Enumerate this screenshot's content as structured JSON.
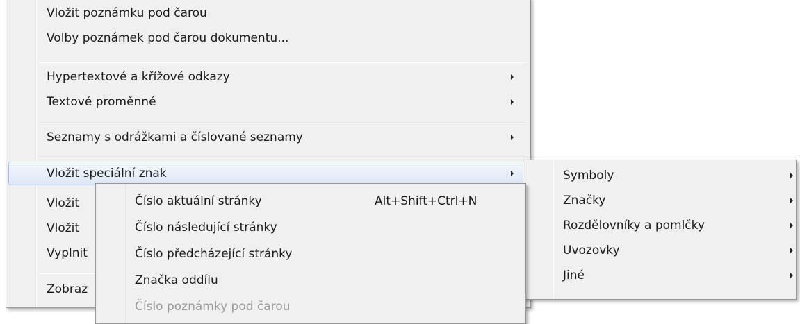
{
  "main_menu": {
    "items": [
      {
        "label": "Vložit poznámku pod čarou"
      },
      {
        "label": "Volby poznámek pod čarou dokumentu..."
      },
      {
        "label": "Hypertextové a křížové odkazy"
      },
      {
        "label": "Textové proměnné"
      },
      {
        "label": "Seznamy s odrážkami a číslované seznamy"
      },
      {
        "label": "Vložit speciální znak"
      },
      {
        "label": "Vložit"
      },
      {
        "label": "Vložit"
      },
      {
        "label": "Vyplnit"
      },
      {
        "label": "Zobraz"
      }
    ]
  },
  "submenu": {
    "items": [
      {
        "label": "Číslo aktuální stránky",
        "shortcut": "Alt+Shift+Ctrl+N"
      },
      {
        "label": "Číslo následující stránky"
      },
      {
        "label": "Číslo předcházející stránky"
      },
      {
        "label": "Značka oddílu"
      },
      {
        "label": "Číslo poznámky pod čarou",
        "disabled": true
      }
    ]
  },
  "special_char_menu": {
    "items": [
      {
        "label": "Symboly"
      },
      {
        "label": "Značky"
      },
      {
        "label": "Rozdělovníky a pomlčky"
      },
      {
        "label": "Uvozovky"
      },
      {
        "label": "Jiné"
      }
    ]
  }
}
